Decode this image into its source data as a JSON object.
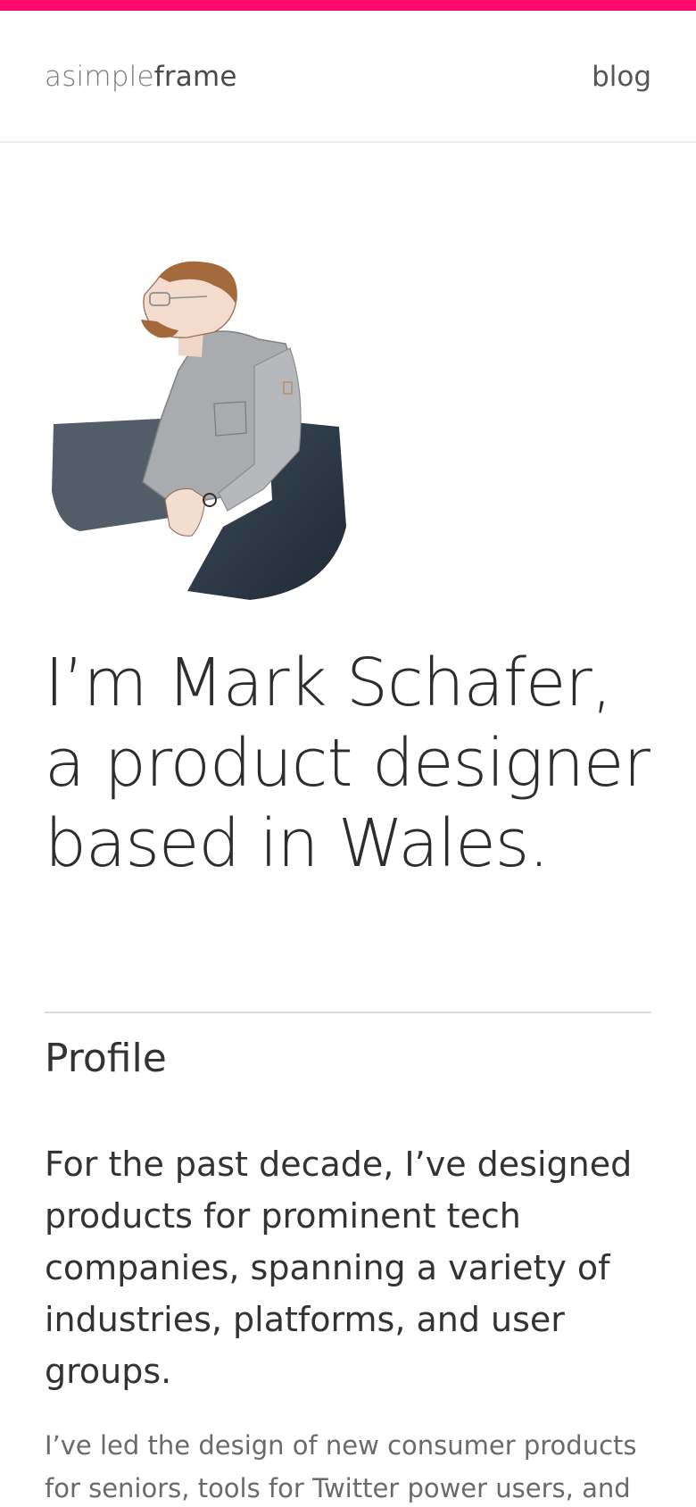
{
  "accent_color": "#ff0a6c",
  "header": {
    "logo_light": "asimple",
    "logo_bold": "frame",
    "nav_blog": "blog"
  },
  "hero": {
    "image": "portrait-illustration",
    "line1": "I’m Mark Schafer,",
    "line2": "a product designer",
    "line3": "based in Wales."
  },
  "profile": {
    "title": "Profile",
    "lead": "For the past decade, I’ve designed products for prominent tech companies, spanning a variety of industries, platforms, and user groups.",
    "body": "I’ve led the design of new consumer products for seniors, tools for Twitter power users, and"
  }
}
